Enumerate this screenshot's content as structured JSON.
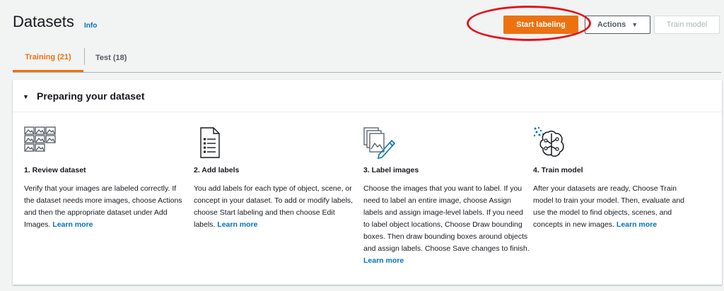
{
  "header": {
    "title": "Datasets",
    "info_link": "Info",
    "start_labeling_label": "Start labeling",
    "actions_label": "Actions",
    "actions_caret": "▼",
    "train_model_label": "Train model"
  },
  "tabs": [
    {
      "label": "Training (21)",
      "active": true
    },
    {
      "label": "Test (18)",
      "active": false
    }
  ],
  "panel": {
    "caret": "▼",
    "title": "Preparing your dataset"
  },
  "steps": [
    {
      "icon": "image-grid-icon",
      "title": "1. Review dataset",
      "body": "Verify that your images are labeled correctly. If the dataset needs more images, choose Actions and then the appropriate dataset under Add Images.",
      "link": "Learn more"
    },
    {
      "icon": "document-list-icon",
      "title": "2. Add labels",
      "body": "You add labels for each type of object, scene, or concept in your dataset. To add or modify labels, choose Start labeling and then choose Edit labels.",
      "link": "Learn more"
    },
    {
      "icon": "label-images-pencil-icon",
      "title": "3. Label images",
      "body": "Choose the images that you want to label. If you need to label an entire image, choose Assign labels and assign image-level labels. If you need to label object locations, Choose Draw bounding boxes. Then draw bounding boxes around objects and assign labels. Choose Save changes to finish.",
      "link": "Learn more"
    },
    {
      "icon": "brain-network-icon",
      "title": "4. Train model",
      "body": "After your datasets are ready, Choose Train model to train your model. Then, evaluate and use the model to find objects, scenes, and concepts in new images.",
      "link": "Learn more"
    }
  ],
  "colors": {
    "primary_button": "#ec7211",
    "link": "#0073bb",
    "highlight_ellipse": "#e3121b",
    "background": "#f2f3f3"
  }
}
